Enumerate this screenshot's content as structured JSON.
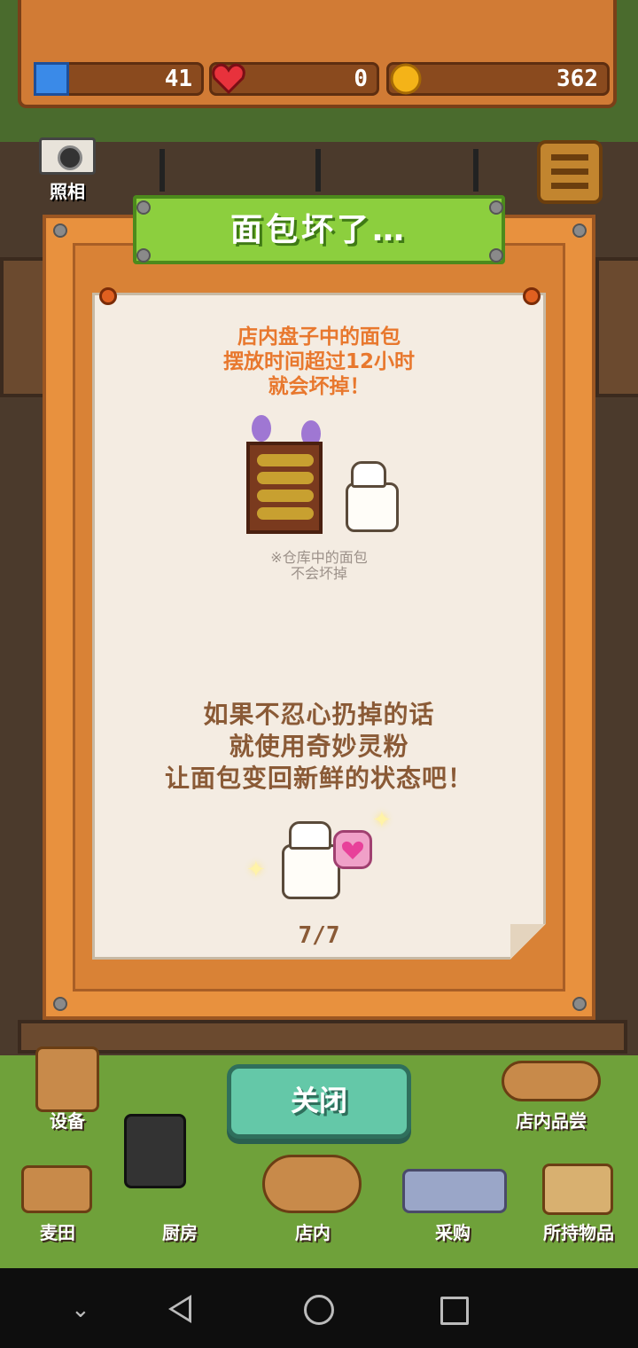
{
  "header": {
    "tickets": "41",
    "hearts": "0",
    "coins": "362"
  },
  "camera": {
    "label": "照相"
  },
  "dialog": {
    "title": "面包坏了…",
    "line1": "店内盘子中的面包",
    "line2": "摆放时间超过12小时",
    "line3": "就会坏掉！",
    "note1": "※仓库中的面包",
    "note2": "不会坏掉",
    "tip1": "如果不忍心扔掉的话",
    "tip2": "就使用奇妙灵粉",
    "tip3": "让面包变回新鲜的状态吧！",
    "page": "7/7"
  },
  "close_button": {
    "label": "关闭"
  },
  "scene_buttons": {
    "equipment": "设备",
    "tasting": "店内品尝"
  },
  "bottom_tabs": [
    "麦田",
    "厨房",
    "店内",
    "采购",
    "所持物品"
  ],
  "colors": {
    "title_green": "#8ccf3e",
    "close_teal": "#64c8a8",
    "text_orange": "#e8782e",
    "text_brown": "#8a5a36"
  }
}
